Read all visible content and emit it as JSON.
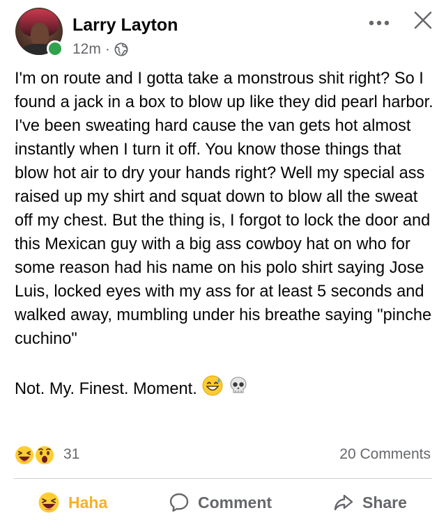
{
  "post": {
    "author": "Larry Layton",
    "time": "12m",
    "separator": "·",
    "privacy_icon": "globe-icon",
    "body": "I'm on route and I gotta take a monstrous shit right? So I found a jack in a box to blow up like they did pearl harbor. I've been sweating hard cause the van gets hot almost instantly when I turn it off. You know those things that blow hot air to dry your hands right? Well my special ass raised up my shirt and squat down to blow all the sweat off my chest. But the thing is, I forgot to lock the door and this Mexican guy with a big ass cowboy hat on who for some reason had his name on his polo shirt saying Jose Luis, locked eyes with my ass for at least 5 seconds and walked away, mumbling under his breathe saying \"pinche cuchino\"",
    "closing": "Not. My. Finest. Moment.",
    "closing_emojis": [
      "grinning-sweat-emoji",
      "skull-emoji"
    ]
  },
  "reactions": {
    "icons": [
      "haha-reaction",
      "wow-reaction"
    ],
    "count": "31",
    "comments": "20 Comments"
  },
  "actions": {
    "haha": "Haha",
    "comment": "Comment",
    "share": "Share"
  },
  "colors": {
    "haha_active": "#f7b125",
    "muted": "#65676b",
    "online": "#31a24c",
    "text": "#050505"
  }
}
